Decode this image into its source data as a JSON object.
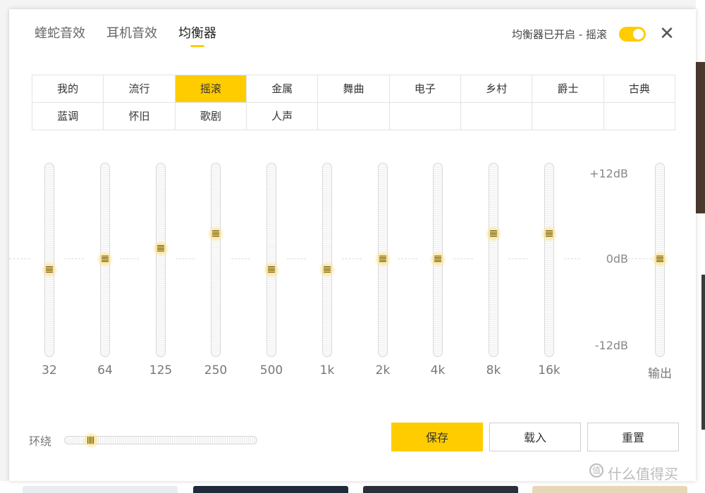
{
  "tabs": [
    {
      "label": "蝰蛇音效"
    },
    {
      "label": "耳机音效"
    },
    {
      "label": "均衡器"
    }
  ],
  "status_text": "均衡器已开启 - 摇滚",
  "toggle_on": true,
  "close_icon": "close-icon",
  "presets": [
    {
      "label": "我的"
    },
    {
      "label": "流行"
    },
    {
      "label": "摇滚"
    },
    {
      "label": "金属"
    },
    {
      "label": "舞曲"
    },
    {
      "label": "电子"
    },
    {
      "label": "乡村"
    },
    {
      "label": "爵士"
    },
    {
      "label": "古典"
    },
    {
      "label": "蓝调"
    },
    {
      "label": "怀旧"
    },
    {
      "label": "歌剧"
    },
    {
      "label": "人声"
    },
    {
      "label": ""
    },
    {
      "label": ""
    },
    {
      "label": ""
    },
    {
      "label": ""
    },
    {
      "label": ""
    }
  ],
  "active_preset": "摇滚",
  "db_scale": {
    "top": "+12dB",
    "mid": "0dB",
    "bottom": "-12dB"
  },
  "bands": [
    {
      "label": "32",
      "gain_db": -1.5
    },
    {
      "label": "64",
      "gain_db": 0
    },
    {
      "label": "125",
      "gain_db": 1.5
    },
    {
      "label": "250",
      "gain_db": 3.5
    },
    {
      "label": "500",
      "gain_db": -1.5
    },
    {
      "label": "1k",
      "gain_db": -1.5
    },
    {
      "label": "2k",
      "gain_db": 0
    },
    {
      "label": "4k",
      "gain_db": 0
    },
    {
      "label": "8k",
      "gain_db": 3.5
    },
    {
      "label": "16k",
      "gain_db": 3.5
    }
  ],
  "output": {
    "label": "输出",
    "gain_db": 0
  },
  "surround": {
    "label": "环绕",
    "level": 0.1
  },
  "buttons": {
    "save": "保存",
    "load": "载入",
    "reset": "重置"
  },
  "watermark": {
    "text": "什么值得买",
    "icon_glyph": "值"
  },
  "accent_color": "#ffcc00"
}
